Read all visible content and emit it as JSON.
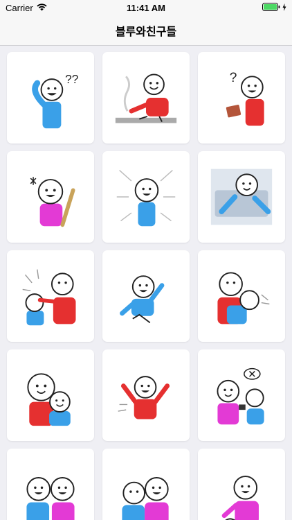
{
  "status": {
    "carrier": "Carrier",
    "time": "11:41 AM"
  },
  "nav": {
    "title": "블루와친구들"
  },
  "stickers": [
    {
      "name": "blue-confused-sticker",
      "bubble": "??"
    },
    {
      "name": "red-relaxing-sticker",
      "bubble": ""
    },
    {
      "name": "red-reading-question-sticker",
      "bubble": "?"
    },
    {
      "name": "pink-bat-sticker",
      "bubble": ""
    },
    {
      "name": "blue-shocked-sticker",
      "bubble": ""
    },
    {
      "name": "blue-in-bed-sticker",
      "bubble": ""
    },
    {
      "name": "red-hitting-blue-sticker",
      "bubble": ""
    },
    {
      "name": "blue-cheering-sticker",
      "bubble": ""
    },
    {
      "name": "red-hugging-sticker",
      "bubble": ""
    },
    {
      "name": "red-blue-pair-sticker",
      "bubble": ""
    },
    {
      "name": "red-celebrating-sticker",
      "bubble": ""
    },
    {
      "name": "pink-blue-chat-sticker",
      "bubble": ""
    },
    {
      "name": "blue-pink-friends-sticker",
      "bubble": ""
    },
    {
      "name": "blue-pink-hug-sticker",
      "bubble": ""
    },
    {
      "name": "pink-sitting-sticker",
      "bubble": ""
    }
  ]
}
